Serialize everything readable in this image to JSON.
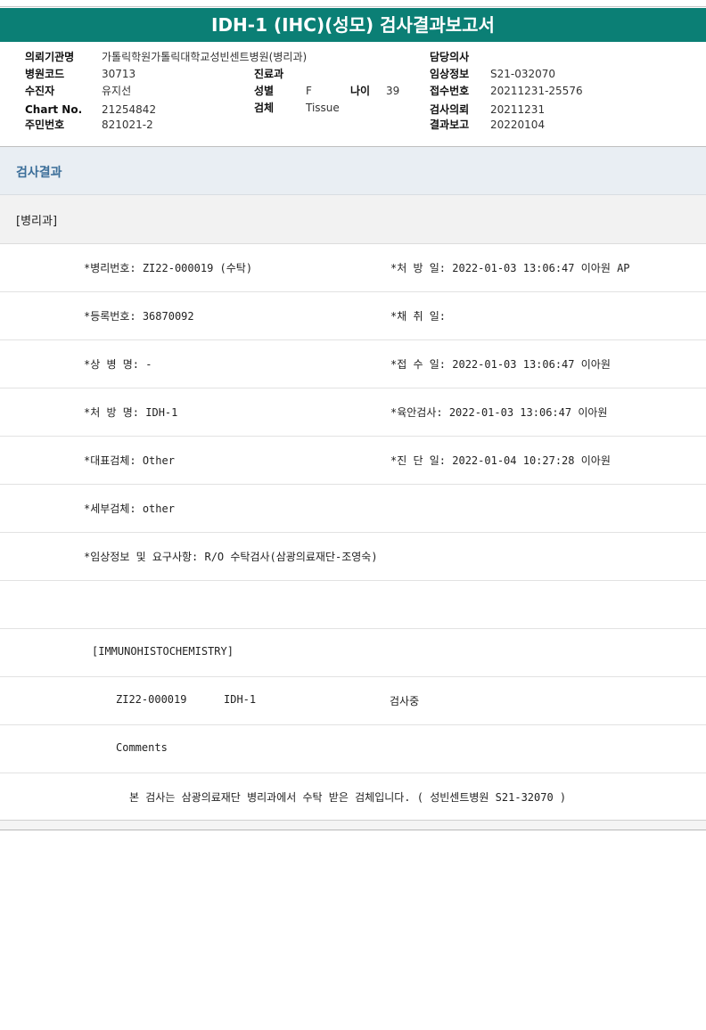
{
  "title": "IDH-1 (IHC)(성모) 검사결과보고서",
  "header": {
    "institution_label": "의뢰기관명",
    "institution_value": "가톨릭학원가톨릭대학교성빈센트병원(병리과)",
    "hospital_code_label": "병원코드",
    "hospital_code_value": "30713",
    "patient_label": "수진자",
    "patient_value": "유지선",
    "chart_label": "Chart No.",
    "chart_value": "21254842",
    "resident_label": "주민번호",
    "resident_value": "821021-2",
    "dept_label": "진료과",
    "dept_value": "",
    "sex_label": "성별",
    "sex_value": "F",
    "age_label": "나이",
    "age_value": "39",
    "specimen_label": "검체",
    "specimen_value": "Tissue",
    "doctor_label": "담당의사",
    "doctor_value": "",
    "clinical_label": "임상정보",
    "clinical_value": "S21-032070",
    "receipt_label": "접수번호",
    "receipt_value": "20211231-25576",
    "request_label": "검사의뢰",
    "request_value": "20211231",
    "report_label": "결과보고",
    "report_value": "20220104"
  },
  "section_result": "검사결과",
  "section_dept": "[병리과]",
  "rows": [
    {
      "left": "*병리번호: ZI22-000019 (수탁)",
      "right": "*처 방 일: 2022-01-03 13:06:47  이아원 AP"
    },
    {
      "left": "*등록번호: 36870092",
      "right": "*채 취 일:"
    },
    {
      "left": "*상 병 명: -",
      "right": "*접 수 일: 2022-01-03 13:06:47  이아원"
    },
    {
      "left": "*처 방 명: IDH-1",
      "right": "*육안검사: 2022-01-03 13:06:47  이아원"
    },
    {
      "left": "*대표검체: Other",
      "right": "*진 단 일: 2022-01-04 10:27:28  이아원"
    },
    {
      "left": "*세부검체: other",
      "right": ""
    },
    {
      "left": "*임상정보 및 요구사항: R/O 수탁검사(삼광의료재단-조영숙)",
      "right": ""
    },
    {
      "left": "",
      "right": ""
    }
  ],
  "ihc_heading": "[IMMUNOHISTOCHEMISTRY]",
  "ihc_item": {
    "number": "ZI22-000019",
    "test": "IDH-1",
    "status": "검사중"
  },
  "comments_label": "Comments",
  "comments_text": "본 검사는 삼광의료재단 병리과에서 수탁 받은 검체입니다. ( 성빈센트병원 S21-32070 )"
}
